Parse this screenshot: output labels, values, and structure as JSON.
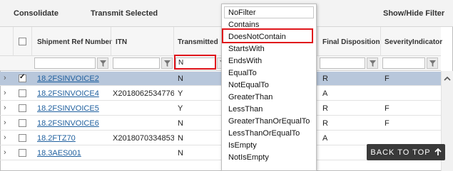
{
  "toolbar": {
    "consolidate": "Consolidate",
    "transmit_selected": "Transmit Selected",
    "show_hide_filter": "Show/Hide Filter"
  },
  "columns": {
    "shipment_ref": "Shipment Ref Number",
    "itn": "ITN",
    "transmitted": "Transmitted",
    "final_disposition": "Final Disposition",
    "severity": "SeverityIndicator"
  },
  "filters": {
    "transmitted_value": "N"
  },
  "rows": [
    {
      "ref": "18.2FSINVOICE2",
      "itn": "",
      "transmitted": "N",
      "final": "R",
      "severity": "F",
      "checked": true
    },
    {
      "ref": "18.2FSINVOICE4",
      "itn": "X2018062534776",
      "transmitted": "Y",
      "final": "A",
      "severity": "",
      "checked": false
    },
    {
      "ref": "18.2FSINVOICE5",
      "itn": "",
      "transmitted": "Y",
      "final": "R",
      "severity": "F",
      "checked": false
    },
    {
      "ref": "18.2FSINVOICE6",
      "itn": "",
      "transmitted": "N",
      "final": "R",
      "severity": "F",
      "checked": false
    },
    {
      "ref": "18.2FTZ70",
      "itn": "X2018070334853",
      "transmitted": "N",
      "final": "A",
      "severity": "",
      "checked": false
    },
    {
      "ref": "18.3AES001",
      "itn": "",
      "transmitted": "N",
      "final": "",
      "severity": "",
      "checked": false
    }
  ],
  "filter_menu": {
    "items": [
      "NoFilter",
      "Contains",
      "DoesNotContain",
      "StartsWith",
      "EndsWith",
      "EqualTo",
      "NotEqualTo",
      "GreaterThan",
      "LessThan",
      "GreaterThanOrEqualTo",
      "LessThanOrEqualTo",
      "IsEmpty",
      "NotIsEmpty"
    ],
    "highlighted": "DoesNotContain"
  },
  "back_to_top": "BACK TO TOP",
  "colors": {
    "accent_red": "#e0151b",
    "link": "#1f5f9e",
    "selected_row": "#b8c7db"
  }
}
